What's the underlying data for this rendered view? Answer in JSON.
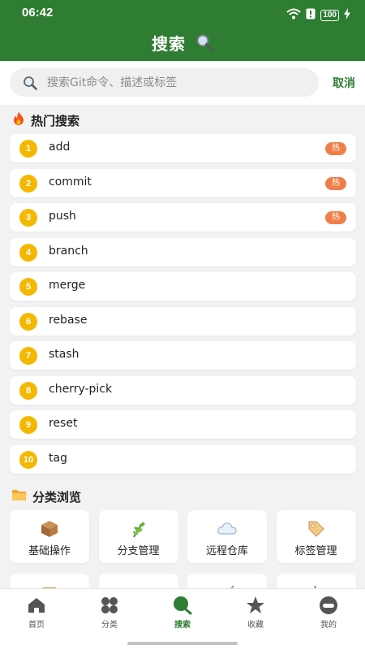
{
  "status": {
    "time": "06:42",
    "battery": "100"
  },
  "header": {
    "title": "搜索"
  },
  "search": {
    "placeholder": "搜索Git命令、描述或标签",
    "cancel_label": "取消"
  },
  "hot": {
    "title": "热门搜索",
    "badge_label": "热",
    "items": [
      {
        "rank": "1",
        "command": "add",
        "hot": true
      },
      {
        "rank": "2",
        "command": "commit",
        "hot": true
      },
      {
        "rank": "3",
        "command": "push",
        "hot": true
      },
      {
        "rank": "4",
        "command": "branch",
        "hot": false
      },
      {
        "rank": "5",
        "command": "merge",
        "hot": false
      },
      {
        "rank": "6",
        "command": "rebase",
        "hot": false
      },
      {
        "rank": "7",
        "command": "stash",
        "hot": false
      },
      {
        "rank": "8",
        "command": "cherry-pick",
        "hot": false
      },
      {
        "rank": "9",
        "command": "reset",
        "hot": false
      },
      {
        "rank": "10",
        "command": "tag",
        "hot": false
      }
    ]
  },
  "categories": {
    "title": "分类浏览",
    "items": [
      {
        "label": "基础操作",
        "icon": "package-icon"
      },
      {
        "label": "分支管理",
        "icon": "herb-icon"
      },
      {
        "label": "远程仓库",
        "icon": "cloud-icon"
      },
      {
        "label": "标签管理",
        "icon": "tag-icon"
      },
      {
        "label": "",
        "icon": "scroll-icon"
      },
      {
        "label": "",
        "icon": "gear-icon"
      },
      {
        "label": "",
        "icon": "broom-icon"
      },
      {
        "label": "",
        "icon": "wrench-icon"
      }
    ]
  },
  "nav": {
    "items": [
      {
        "label": "首页",
        "icon": "home-icon"
      },
      {
        "label": "分类",
        "icon": "category-icon"
      },
      {
        "label": "搜索",
        "icon": "search-icon",
        "active": true
      },
      {
        "label": "收藏",
        "icon": "star-icon"
      },
      {
        "label": "我的",
        "icon": "profile-icon"
      }
    ]
  },
  "colors": {
    "primary": "#2e7d32",
    "rank": "#f5b800",
    "hot_badge": "#ef7f4a"
  }
}
